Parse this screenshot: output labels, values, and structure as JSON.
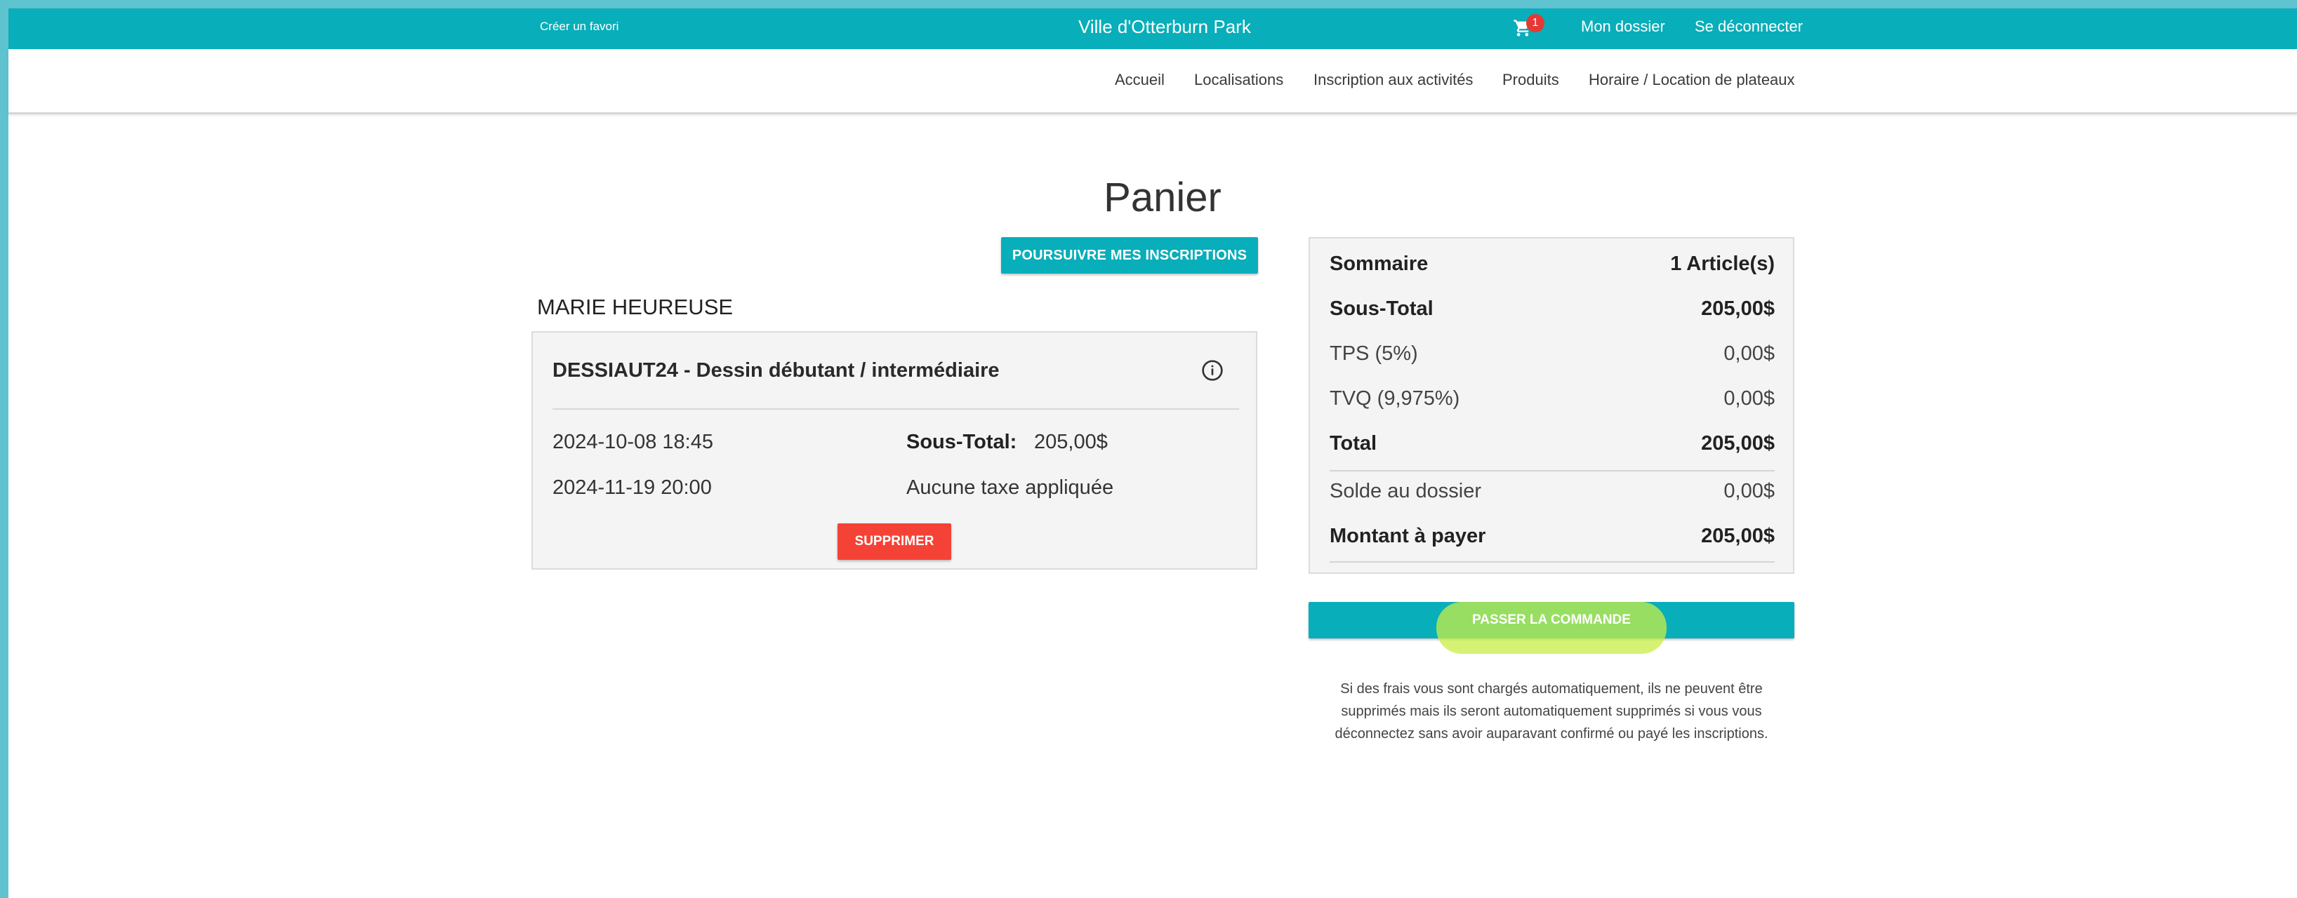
{
  "topbar": {
    "favorite_link": "Créer un favori",
    "city_name": "Ville d'Otterburn Park",
    "cart_icon": "shopping-cart-icon",
    "cart_count": "1",
    "my_file": "Mon dossier",
    "logout": "Se déconnecter"
  },
  "nav": {
    "items": [
      "Accueil",
      "Localisations",
      "Inscription aux activités",
      "Produits",
      "Horaire / Location de plateaux"
    ]
  },
  "page": {
    "title": "Panier",
    "continue_button": "POURSUIVRE MES INSCRIPTIONS"
  },
  "participant": {
    "name": "MARIE HEUREUSE",
    "item": {
      "title": "DESSIAUT24 - Dessin débutant / intermédiaire",
      "info_icon": "info-circle-icon",
      "start_date": "2024-10-08 18:45",
      "end_date": "2024-11-19 20:00",
      "subtotal_label": "Sous-Total:",
      "subtotal_value": "205,00$",
      "tax_note": "Aucune taxe appliquée",
      "delete_button": "SUPPRIMER"
    }
  },
  "summary": {
    "title_label": "Sommaire",
    "article_count": "1 Article(s)",
    "subtotal_label": "Sous-Total",
    "subtotal_value": "205,00$",
    "tps_label": "TPS (5%)",
    "tps_value": "0,00$",
    "tvq_label": "TVQ (9,975%)",
    "tvq_value": "0,00$",
    "total_label": "Total",
    "total_value": "205,00$",
    "balance_label": "Solde au dossier",
    "balance_value": "0,00$",
    "amount_due_label": "Montant à payer",
    "amount_due_value": "205,00$"
  },
  "order": {
    "button": "PASSER LA COMMANDE",
    "note": "Si des frais vous sont chargés automatiquement, ils ne peuvent être supprimés mais ils seront automatiquement supprimés si vous vous déconnectez sans avoir auparavant confirmé ou payé les inscriptions."
  },
  "colors": {
    "brand_teal": "#08aeb9",
    "danger_red": "#f44336",
    "highlight_yellow": "#c8ee46"
  }
}
